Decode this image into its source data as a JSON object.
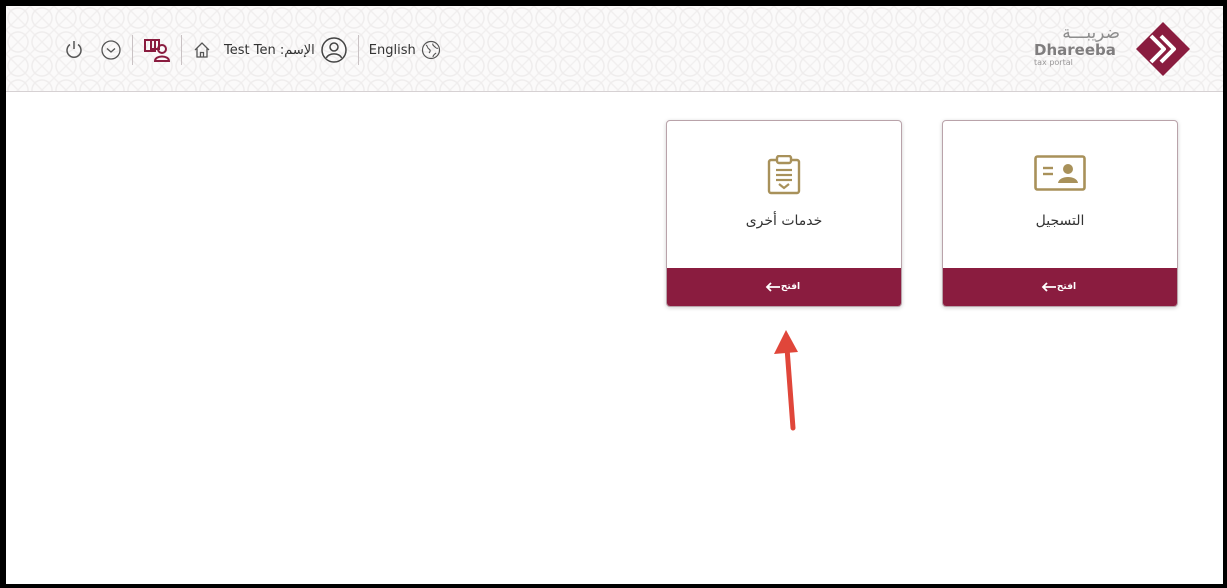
{
  "header": {
    "brand": {
      "arabic": "ضريبـــة",
      "name": "Dhareeba",
      "tagline": "tax portal"
    },
    "language_label": "English",
    "user_label": "الإسم: Test Ten"
  },
  "cards": [
    {
      "title": "خدمات أخرى",
      "action_label": "افتح"
    },
    {
      "title": "التسجيل",
      "action_label": "افتح"
    }
  ],
  "colors": {
    "brand": "#8a1c3f",
    "icon_gold": "#a8915a",
    "annotation_arrow": "#e0463a"
  },
  "icons": [
    "power-icon",
    "chevron-down-icon",
    "user-switch-icon",
    "home-icon",
    "user-avatar-icon",
    "globe-icon",
    "clipboard-icon",
    "id-card-icon",
    "arrow-left-icon"
  ]
}
